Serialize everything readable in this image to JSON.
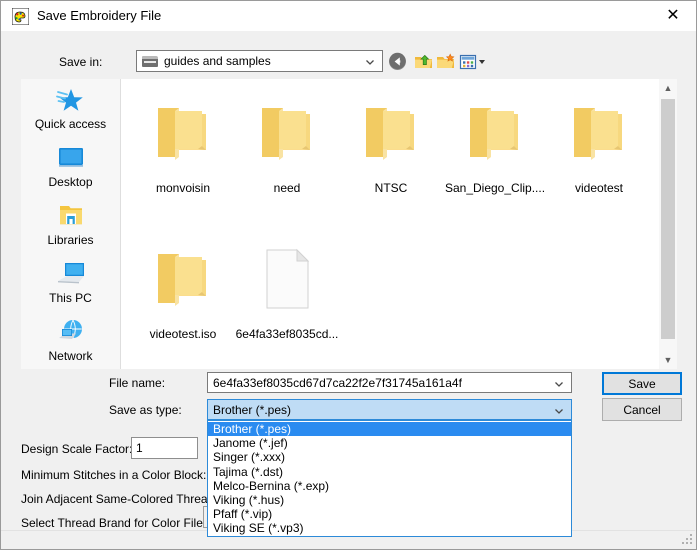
{
  "window": {
    "title": "Save Embroidery File",
    "icon": "embroidery-palette-icon",
    "close_label": "✕"
  },
  "toolbar": {
    "save_in_label": "Save in:",
    "save_in_value": "guides and samples",
    "back_title": "Back",
    "up_title": "Up one level",
    "new_folder_title": "Create New Folder",
    "views_title": "Views"
  },
  "places": {
    "items": [
      {
        "label": "Quick access",
        "icon": "quick-access-star-icon"
      },
      {
        "label": "Desktop",
        "icon": "desktop-monitor-icon"
      },
      {
        "label": "Libraries",
        "icon": "libraries-folder-icon"
      },
      {
        "label": "This PC",
        "icon": "this-pc-computer-icon"
      },
      {
        "label": "Network",
        "icon": "network-globe-icon"
      }
    ]
  },
  "file_list": {
    "items": [
      {
        "name": "monvoisin",
        "type": "folder"
      },
      {
        "name": "need",
        "type": "folder"
      },
      {
        "name": "NTSC",
        "type": "folder"
      },
      {
        "name": "San_Diego_Clip....",
        "type": "folder"
      },
      {
        "name": "videotest",
        "type": "folder"
      },
      {
        "name": "videotest.iso",
        "type": "folder"
      },
      {
        "name": "6e4fa33ef8035cd...",
        "type": "document"
      }
    ]
  },
  "form": {
    "file_name_label": "File name:",
    "file_name_value": "6e4fa33ef8035cd67d7ca22f2e7f31745a161a4f",
    "save_as_type_label": "Save as type:",
    "save_as_type_value": "Brother (*.pes)",
    "save_as_type_options": [
      "Brother (*.pes)",
      "Janome (*.jef)",
      "Singer (*.xxx)",
      "Tajima (*.dst)",
      "Melco-Bernina (*.exp)",
      "Viking (*.hus)",
      "Pfaff (*.vip)",
      "Viking SE (*.vp3)"
    ],
    "save_as_type_selected_index": 0
  },
  "buttons": {
    "save_label": "Save",
    "cancel_label": "Cancel"
  },
  "options": {
    "design_scale_factor_label": "Design Scale Factor:",
    "design_scale_factor_value": "1",
    "minimum_stitches_label": "Minimum Stitches in a Color Block:",
    "join_threads_label": "Join Adjacent Same-Colored Threads",
    "thread_brand_label": "Select Thread Brand for Color File"
  },
  "colors": {
    "accent": "#0078d7",
    "selection": "#2a8bf0",
    "combo_highlight": "#bfdcf5",
    "folder": "#f8d775",
    "dialog_bg": "#f0f0f0"
  }
}
